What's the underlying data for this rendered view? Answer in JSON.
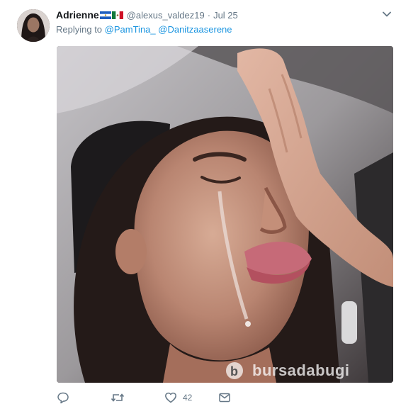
{
  "tweet": {
    "display_name": "Adrienne",
    "flags": [
      "el-salvador-flag",
      "mexico-flag"
    ],
    "handle": "@alexus_valdez19",
    "separator": "·",
    "date": "Jul 25",
    "replying_prefix": "Replying to",
    "replying_to": [
      "@PamTina_",
      "@Danitzaaserene"
    ],
    "media_watermark": "bursadabugi",
    "actions": {
      "reply_icon": "reply-icon",
      "retweet_icon": "retweet-icon",
      "like_icon": "heart-icon",
      "like_count": "42",
      "dm_icon": "envelope-icon"
    },
    "colors": {
      "link": "#1b95e0",
      "secondary_text": "#657786",
      "primary_text": "#14171a"
    }
  }
}
